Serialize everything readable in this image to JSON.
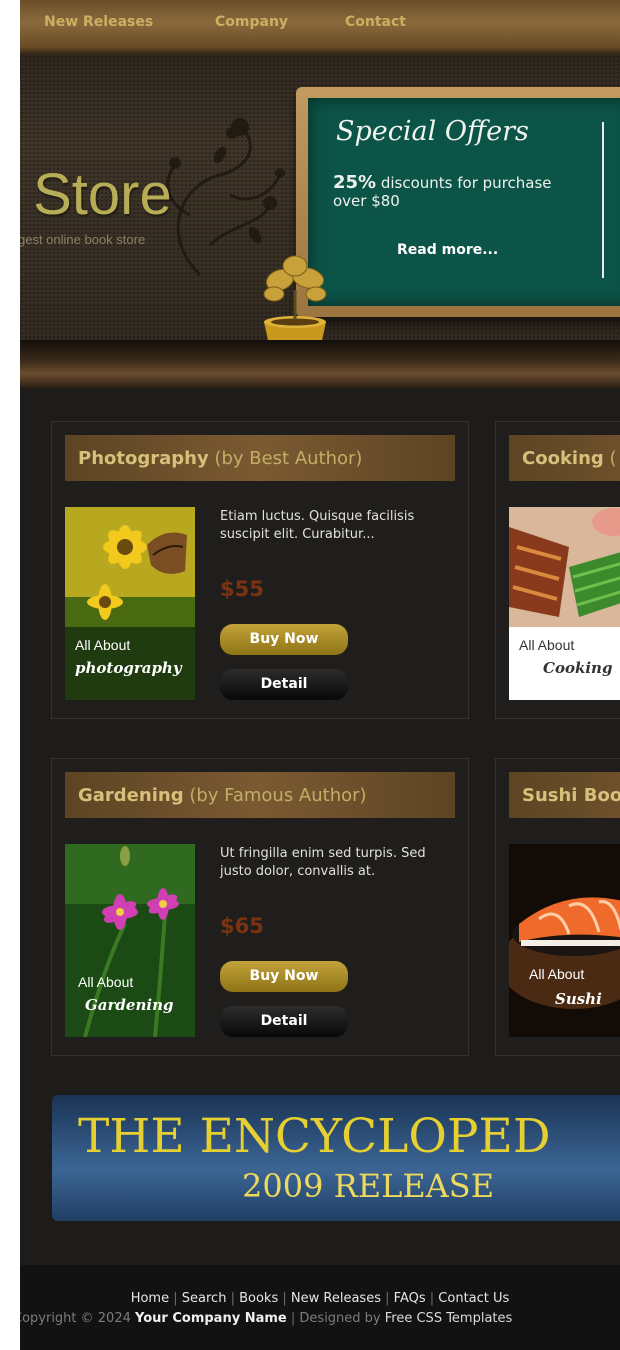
{
  "nav": {
    "items": [
      "New Releases",
      "Company",
      "Contact"
    ]
  },
  "header": {
    "title": "Book Store",
    "title_visible": "k Store",
    "tagline": "gest online book store"
  },
  "offer": {
    "title": "Special Offers",
    "percent": "25%",
    "text": " discounts for purchase over $80",
    "read_more": "Read more..."
  },
  "products": [
    {
      "title": "Photography",
      "author": "(by Best Author)",
      "cover_line1": "All About",
      "cover_line2": "photography",
      "description": "Etiam luctus. Quisque facilisis suscipit elit. Curabitur...",
      "price": "$55",
      "buy_label": "Buy Now",
      "detail_label": "Detail"
    },
    {
      "title": "Cooking",
      "author": "(",
      "cover_line1": "All About",
      "cover_line2": "Cooking"
    },
    {
      "title": "Gardening",
      "author": "(by Famous Author)",
      "cover_line1": "All About",
      "cover_line2": "Gardening",
      "description": "Ut fringilla enim sed turpis. Sed justo dolor, convallis at.",
      "price": "$65",
      "buy_label": "Buy Now",
      "detail_label": "Detail"
    },
    {
      "title": "Sushi Boo",
      "author": "",
      "cover_line1": "All About",
      "cover_line2": "Sushi"
    }
  ],
  "banner": {
    "line1": "THE ENCYCLOPED",
    "line2": "2009 RELEASE"
  },
  "footer": {
    "links": [
      "Home",
      "Search",
      "Books",
      "New Releases",
      "FAQs",
      "Contact Us"
    ],
    "separator": "|",
    "copyright": "Copyright © 2024",
    "company": "Your Company Name",
    "designed_by": "Designed by",
    "designer": "Free CSS Templates"
  },
  "colors": {
    "accent_gold": "#c9b063",
    "price": "#7a3312",
    "board_green": "#0c5447",
    "banner_blue": "#345a86"
  }
}
